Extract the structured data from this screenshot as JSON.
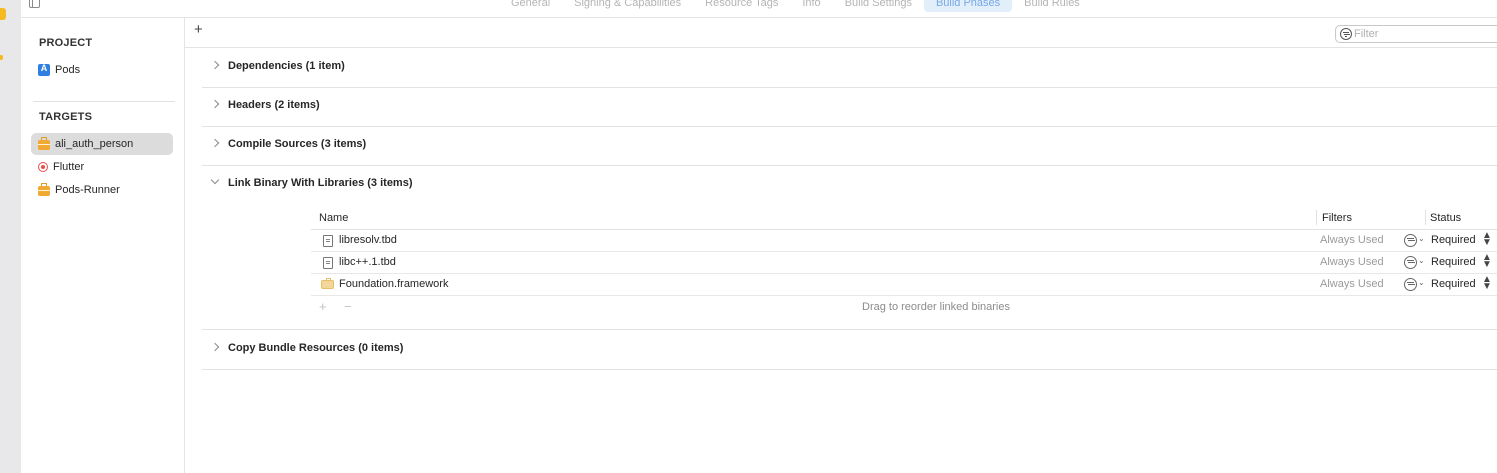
{
  "tabs": [
    "General",
    "Signing & Capabilities",
    "Resource Tags",
    "Info",
    "Build Settings",
    "Build Phases",
    "Build Rules"
  ],
  "active_tab": "Build Phases",
  "sidebar": {
    "project_header": "PROJECT",
    "project_items": [
      {
        "label": "Pods",
        "icon": "project-icon"
      }
    ],
    "targets_header": "TARGETS",
    "target_items": [
      {
        "label": "ali_auth_person",
        "icon": "briefcase-icon",
        "selected": true
      },
      {
        "label": "Flutter",
        "icon": "target-icon"
      },
      {
        "label": "Pods-Runner",
        "icon": "briefcase-icon"
      }
    ]
  },
  "toolbar": {
    "add_label": "+",
    "filter_placeholder": "Filter"
  },
  "phases": [
    {
      "title": "Dependencies (1 item)",
      "expanded": false
    },
    {
      "title": "Headers (2 items)",
      "expanded": false
    },
    {
      "title": "Compile Sources (3 items)",
      "expanded": false
    },
    {
      "title": "Link Binary With Libraries (3 items)",
      "expanded": true
    },
    {
      "title": "Copy Bundle Resources (0 items)",
      "expanded": false
    }
  ],
  "libraries": {
    "headers": {
      "name": "Name",
      "filters": "Filters",
      "status": "Status"
    },
    "rows": [
      {
        "name": "libresolv.tbd",
        "icon": "file-icon",
        "filters": "Always Used",
        "status": "Required"
      },
      {
        "name": "libc++.1.tbd",
        "icon": "file-icon",
        "filters": "Always Used",
        "status": "Required"
      },
      {
        "name": "Foundation.framework",
        "icon": "framework-icon",
        "filters": "Always Used",
        "status": "Required"
      }
    ],
    "add_label": "+",
    "remove_label": "−",
    "hint": "Drag to reorder linked binaries"
  },
  "colors": {
    "accent": "#75a8e6",
    "accent_bg": "#e3eefb",
    "selection": "#dcdcdc"
  }
}
